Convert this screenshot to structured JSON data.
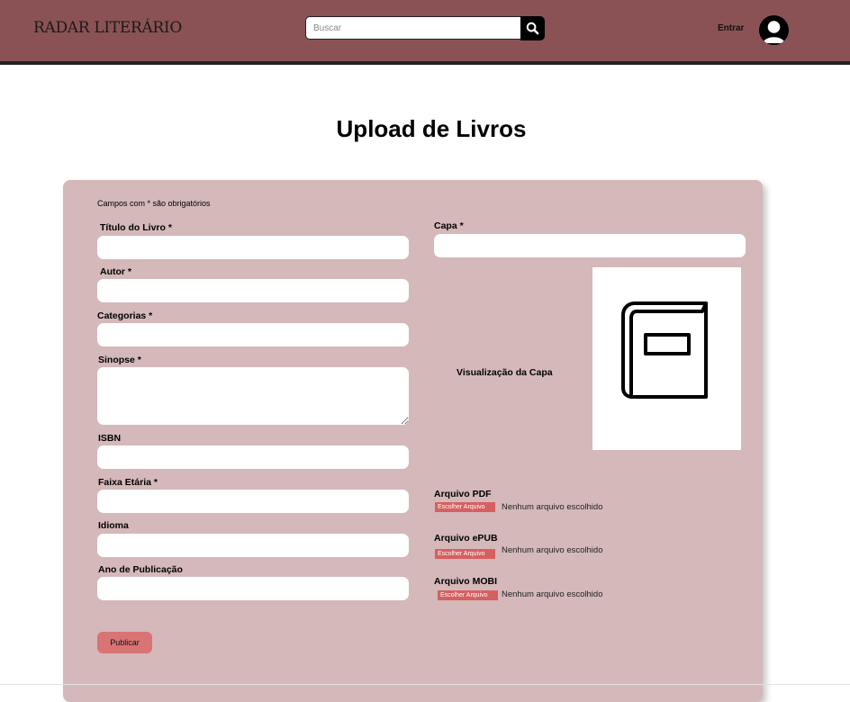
{
  "header": {
    "logo": "RADAR LITERÁRIO",
    "search_placeholder": "Buscar",
    "login_label": "Entrar"
  },
  "page_title": "Upload de Livros",
  "form": {
    "required_note": "Campos com * são obrigatórios",
    "fields": {
      "title": {
        "label": "Título do Livro *",
        "value": ""
      },
      "author": {
        "label": "Autor *",
        "value": ""
      },
      "categories": {
        "label": "Categorias *",
        "value": ""
      },
      "synopsis": {
        "label": "Sinopse *",
        "value": ""
      },
      "isbn": {
        "label": "ISBN",
        "value": ""
      },
      "age_range": {
        "label": "Faixa Etária *",
        "value": ""
      },
      "language": {
        "label": "Idioma",
        "value": ""
      },
      "publication_year": {
        "label": "Ano de Publicação",
        "value": ""
      }
    },
    "cover": {
      "label": "Capa *",
      "preview_label": "Visualização da Capa"
    },
    "files": [
      {
        "label": "Arquivo PDF",
        "button": "Escolher Arquivo",
        "status": "Nenhum arquivo escolhido"
      },
      {
        "label": "Arquivo ePUB",
        "button": "Escolher Arquivo",
        "status": "Nenhum arquivo escolhido"
      },
      {
        "label": "Arquivo MOBI",
        "button": "Escolher Arquivo",
        "status": "Nenhum arquivo escolhido"
      }
    ],
    "publish_label": "Publicar"
  },
  "colors": {
    "header_bg": "#8b5255",
    "card_bg": "#d5b8ba",
    "accent_button": "#d87474",
    "file_button": "#d65f60"
  },
  "icons": [
    "search-icon",
    "user-avatar-icon",
    "book-icon"
  ]
}
